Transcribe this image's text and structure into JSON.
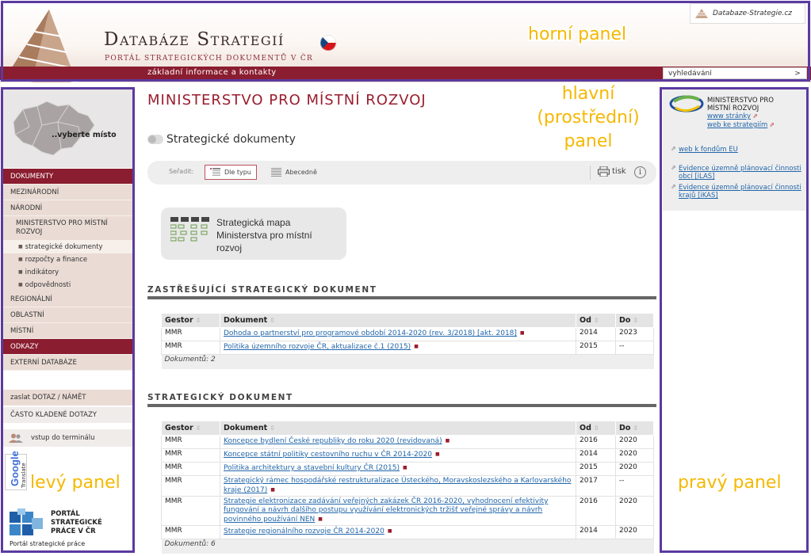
{
  "header": {
    "title": "Databáze Strategií",
    "subtitle": "PORTÁL STRATEGICKÝCH DOKUMENTŮ V ČR",
    "info_link": "základní informace a kontakty",
    "top_link": "Databaze-Strategie.cz",
    "search_placeholder": "vyhledávání",
    "search_go": ">"
  },
  "left": {
    "map_label": "..vyberte místo",
    "menu": [
      {
        "label": "DOKUMENTY",
        "active": true
      },
      {
        "label": "MEZINÁRODNÍ"
      },
      {
        "label": "NÁRODNÍ"
      }
    ],
    "ministry": "MINISTERSTVO PRO MÍSTNÍ ROZVOJ",
    "submenu": [
      "strategické dokumenty",
      "rozpočty a finance",
      "indikátory",
      "odpovědnosti"
    ],
    "menu2": [
      "REGIONÁLNÍ",
      "OBLASTNÍ",
      "MÍSTNÍ"
    ],
    "links_head": "ODKAZY",
    "external": "EXTERNÍ DATABÁZE",
    "ask": "zaslat DOTAZ / NÁMĚT",
    "faq": "ČASTO KLADENÉ DOTAZY",
    "terminal": "vstup do terminálu",
    "google": "Google",
    "translate": "Translate",
    "portal_name": [
      "PORTÁL",
      "STRATEGICKÉ",
      "PRÁCE V ČR"
    ],
    "portal_sub": "Portál strategické práce"
  },
  "right": {
    "org_lines": [
      "MINISTERSTVO PRO",
      "MÍSTNÍ ROZVOJ"
    ],
    "www": "www stránky",
    "web_strategy": "web ke strategiím",
    "eu_funds": "web k fondům EU",
    "ilas": [
      "Evidence územně plánovací činnosti",
      "obcí [iLAS]"
    ],
    "ikas": [
      "Evidence územně plánovací činnosti",
      "krajů [iKAS]"
    ]
  },
  "main": {
    "title": "MINISTERSTVO PRO MÍSTNÍ ROZVOJ",
    "section": "Strategické dokumenty",
    "sort_label": "Seřadit:",
    "sort_type": "Dle typu",
    "sort_alpha": "Abecedně",
    "print": "tisk",
    "info": "i",
    "map_card": [
      "Strategická mapa",
      "Ministerstva pro místní",
      "rozvoj"
    ],
    "columns": [
      "Gestor",
      "Dokument",
      "Od",
      "Do"
    ],
    "group1": {
      "heading": "ZASTŘEŠUJÍCÍ STRATEGICKÝ DOKUMENT",
      "rows": [
        {
          "gestor": "MMR",
          "doc": "Dohoda o partnerství pro programové období 2014-2020 (rev. 3/2018) [akt. 2018]",
          "od": "2014",
          "do": "2023"
        },
        {
          "gestor": "MMR",
          "doc": "Politika územního rozvoje ČR, aktualizace č.1 (2015)",
          "od": "2015",
          "do": "--"
        }
      ],
      "count": "Dokumentů: 2"
    },
    "group2": {
      "heading": "STRATEGICKÝ DOKUMENT",
      "rows": [
        {
          "gestor": "MMR",
          "doc": "Koncepce bydlení České republiky do roku 2020 (revidovaná)",
          "od": "2016",
          "do": "2020"
        },
        {
          "gestor": "MMR",
          "doc": "Koncepce státní politiky cestovního ruchu v ČR 2014-2020",
          "od": "2014",
          "do": "2020"
        },
        {
          "gestor": "MMR",
          "doc": "Politika architektury a stavební kultury ČR (2015)",
          "od": "2015",
          "do": "2020"
        },
        {
          "gestor": "MMR",
          "doc": "Strategický rámec hospodářské restrukturalizace Ústeckého, Moravskoslezského a Karlovarského kraje (2017)",
          "od": "2017",
          "do": "--"
        },
        {
          "gestor": "MMR",
          "doc": "Strategie elektronizace zadávání veřejných zakázek ČR 2016-2020, vyhodnocení efektivity fungování a návrh dalšího postupu využívání elektronických tržišť veřejné správy a návrh povinného používání NEN",
          "od": "2016",
          "do": "2020"
        },
        {
          "gestor": "MMR",
          "doc": "Strategie regionálního rozvoje ČR 2014-2020",
          "od": "2014",
          "do": "2020"
        }
      ],
      "count": "Dokumentů: 6"
    }
  },
  "annotations": {
    "top": "horní panel",
    "main": [
      "hlavní",
      "(prostřední)",
      "panel"
    ],
    "left": "levý panel",
    "right": "pravý panel"
  },
  "colors": {
    "accent": "#8a1d2f",
    "annotation_frame": "#5b3aa0",
    "annotation_text": "#f5b800"
  }
}
